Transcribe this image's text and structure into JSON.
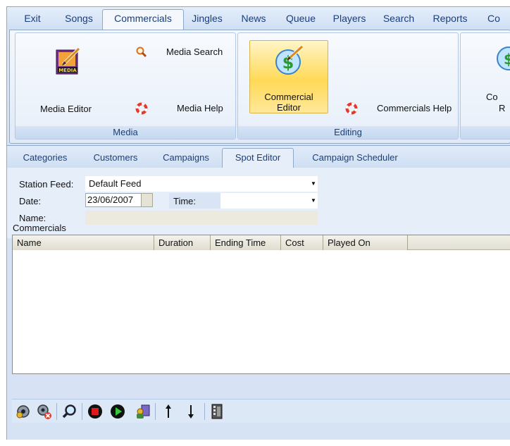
{
  "menu_tabs": [
    "Exit",
    "Songs",
    "Commercials",
    "Jingles",
    "News",
    "Queue",
    "Players",
    "Search",
    "Reports",
    "Co"
  ],
  "active_menu_tab": "Commercials",
  "ribbon": {
    "media_group": {
      "label": "Media",
      "media_editor": "Media Editor",
      "media_search": "Media Search",
      "media_help": "Media Help",
      "media_logo_text": "MEDIA"
    },
    "editing_group": {
      "label": "Editing",
      "commercial_editor_line1": "Commercial",
      "commercial_editor_line2": "Editor",
      "commercials_help": "Commercials Help"
    },
    "partial_group": {
      "text_line1": "Co",
      "text_line2": "R"
    }
  },
  "sub_tabs": [
    "Categories",
    "Customers",
    "Campaigns",
    "Spot Editor",
    "Campaign Scheduler"
  ],
  "active_sub_tab": "Spot Editor",
  "form": {
    "station_feed_label": "Station Feed:",
    "station_feed_value": "Default Feed",
    "date_label": "Date:",
    "date_value": "23/06/2007",
    "time_label": "Time:",
    "time_value": "",
    "name_label": "Name:",
    "name_value": ""
  },
  "commercials_section": {
    "title": "Commercials",
    "columns": [
      "Name",
      "Duration",
      "Ending Time",
      "Cost",
      "Played On"
    ],
    "rows": []
  },
  "toolbar_icons": [
    "add-user-icon",
    "remove-user-icon",
    "search-icon",
    "stop-icon",
    "play-icon",
    "user-media-icon",
    "arrow-up-icon",
    "arrow-down-icon",
    "film-icon"
  ],
  "colors": {
    "accent": "#1b3e7a",
    "active_button": "#ffd957"
  }
}
